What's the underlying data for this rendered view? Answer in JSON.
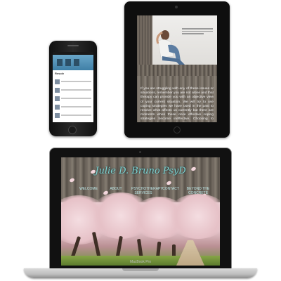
{
  "phone": {
    "screen_title": "Resolv"
  },
  "tablet": {
    "article_text": "If you are struggling with any of these issues or situations, remember you are not alone and that therapy can provide you with an objective view of your current situation. We will try to use coping strategies we have used in the past to resolve what affects us currently but there are moments when these once effective coping strategies become ineffective. Choosing to enter into therapy can be difficult as many feel that doing so is a sign of failure or weakness. This idea couldn't be further"
  },
  "laptop": {
    "brand": "MacBook Pro",
    "site": {
      "title": "Julie D. Bruno PsyD",
      "nav": [
        {
          "label": "WELCOME"
        },
        {
          "label": "ABOUT"
        },
        {
          "label": "PSYCHOTHERAPY SERVICES"
        },
        {
          "label": "CONTACT"
        },
        {
          "label": "BEYOND THE CONCRETE CHANGE"
        }
      ]
    }
  }
}
